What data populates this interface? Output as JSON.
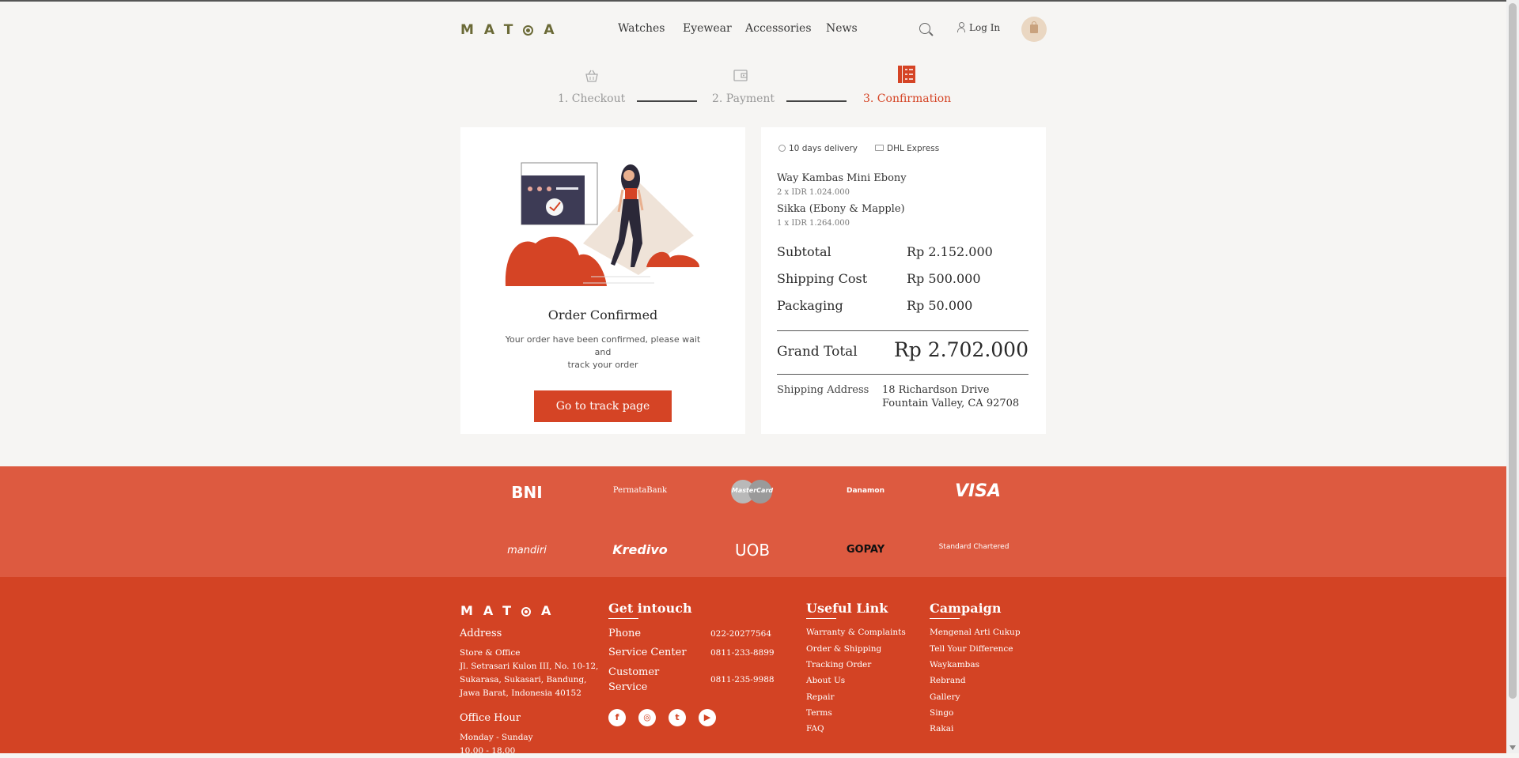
{
  "header": {
    "logo": "MATOA",
    "nav": [
      "Watches",
      "Eyewear",
      "Accessories",
      "News"
    ],
    "login_label": "Log In"
  },
  "steps": [
    {
      "label": "1. Checkout",
      "state": "done"
    },
    {
      "label": "2. Payment",
      "state": "done"
    },
    {
      "label": "3. Confirmation",
      "state": "active"
    }
  ],
  "confirmation": {
    "title": "Order Confirmed",
    "description_line1": "Your order have been confirmed, please wait and",
    "description_line2": "track your order",
    "button_label": "Go to track page"
  },
  "order": {
    "delivery": "10 days delivery",
    "courier": "DHL Express",
    "items": [
      {
        "name": "Way Kambas Mini Ebony",
        "qty": "2 x IDR 1.024.000"
      },
      {
        "name": "Sikka (Ebony & Mapple)",
        "qty": "1 x IDR 1.264.000"
      }
    ],
    "summary": [
      {
        "label": "Subtotal",
        "value": "Rp 2.152.000"
      },
      {
        "label": "Shipping Cost",
        "value": "Rp 500.000"
      },
      {
        "label": "Packaging",
        "value": "Rp 50.000"
      }
    ],
    "grand_total_label": "Grand Total",
    "grand_total_value": "Rp 2.702.000",
    "address_label": "Shipping Address",
    "address_line1": "18 Richardson Drive",
    "address_line2": "Fountain Valley, CA 92708"
  },
  "payment_partners": [
    "BNI",
    "PermataBank",
    "MasterCard",
    "Danamon",
    "VISA",
    "mandiri",
    "Kredivo",
    "UOB",
    "GOPAY",
    "Standard Chartered"
  ],
  "footer": {
    "logo": "MATOA",
    "address_heading": "Address",
    "address_sub": "Store & Office",
    "address_lines": [
      "Jl. Setrasari Kulon III, No. 10-12,",
      "Sukarasa, Sukasari, Bandung,",
      "Jawa Barat, Indonesia 40152"
    ],
    "office_hour_heading": "Office Hour",
    "office_days": "Monday - Sunday",
    "office_time": "10.00 - 18.00",
    "contact_heading": "Get intouch",
    "contacts": [
      {
        "label": "Phone",
        "value": "022-20277564"
      },
      {
        "label": "Service Center",
        "value": "0811-233-8899"
      },
      {
        "label": "Customer",
        "label2": "Service",
        "value": "0811-235-9988"
      }
    ],
    "useful_heading": "Useful Link",
    "useful_links": [
      "Warranty & Complaints",
      "Order & Shipping",
      "Tracking Order",
      "About Us",
      "Repair",
      "Terms",
      "FAQ"
    ],
    "campaign_heading": "Campaign",
    "campaign_links": [
      "Mengenal Arti Cukup",
      "Tell Your Difference",
      "Waykambas",
      "Rebrand",
      "Gallery",
      "Singo",
      "Rakai"
    ],
    "social": [
      "facebook-icon",
      "instagram-icon",
      "twitter-icon",
      "youtube-icon"
    ]
  },
  "colors": {
    "accent": "#d54425",
    "banner": "#dd5a40",
    "footer": "#d34324",
    "logo": "#6b6a37"
  }
}
